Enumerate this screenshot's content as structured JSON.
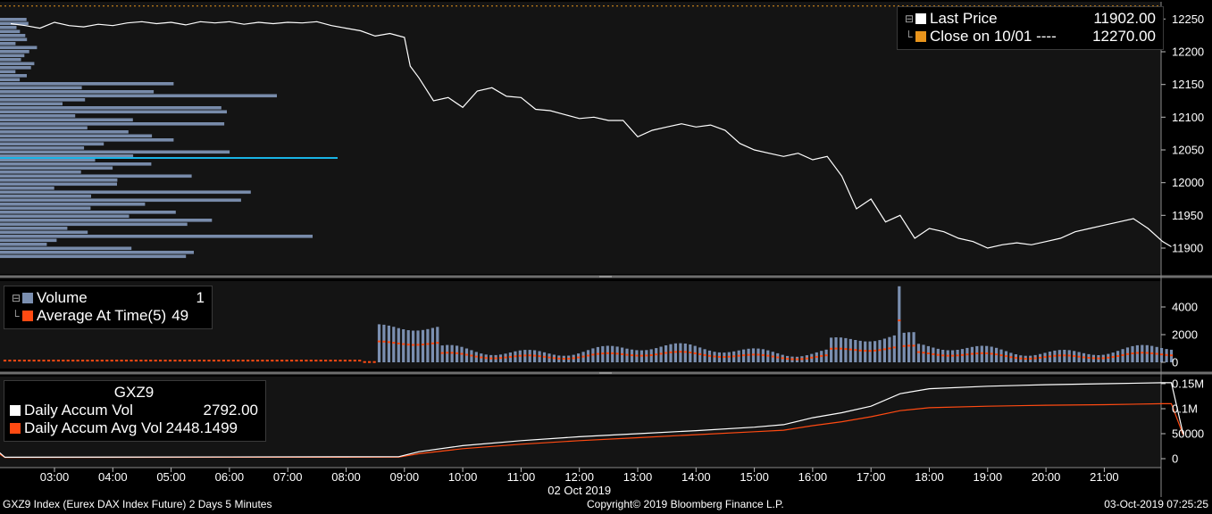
{
  "colors": {
    "background": "#000000",
    "panel": "#141414",
    "separator": "#6e6e6e",
    "price_line": "#ffffff",
    "close_line": "#e8941c",
    "volume_bar": "#7b8fb0",
    "average_marker": "#ff4a12",
    "profile_bar": "#8aa0c4",
    "poc_line": "#19b4e6",
    "accum_vol": "#ffffff",
    "accum_avg": "#ff4a12"
  },
  "chart_data": [
    {
      "type": "line",
      "panel": "price",
      "ylim": [
        11870,
        12270
      ],
      "yticks": [
        11900,
        11950,
        12000,
        12050,
        12100,
        12150,
        12200,
        12250
      ],
      "reference_line": {
        "label": "Close on 10/01",
        "value": 12270.0,
        "style": "dashed"
      },
      "series": [
        {
          "name": "Last Price",
          "last_value": 11902.0,
          "points": [
            [
              2.25,
              12243
            ],
            [
              2.5,
              12240
            ],
            [
              2.75,
              12236
            ],
            [
              3.0,
              12245
            ],
            [
              3.25,
              12240
            ],
            [
              3.5,
              12238
            ],
            [
              3.75,
              12242
            ],
            [
              4.0,
              12240
            ],
            [
              4.25,
              12244
            ],
            [
              4.5,
              12246
            ],
            [
              4.75,
              12243
            ],
            [
              5.0,
              12245
            ],
            [
              5.25,
              12241
            ],
            [
              5.5,
              12246
            ],
            [
              5.75,
              12244
            ],
            [
              6.0,
              12246
            ],
            [
              6.25,
              12242
            ],
            [
              6.5,
              12245
            ],
            [
              6.75,
              12243
            ],
            [
              7.0,
              12245
            ],
            [
              7.25,
              12244
            ],
            [
              7.5,
              12246
            ],
            [
              7.75,
              12240
            ],
            [
              8.0,
              12236
            ],
            [
              8.25,
              12232
            ],
            [
              8.5,
              12224
            ],
            [
              8.75,
              12228
            ],
            [
              9.0,
              12222
            ],
            [
              9.1,
              12178
            ],
            [
              9.25,
              12160
            ],
            [
              9.5,
              12125
            ],
            [
              9.75,
              12130
            ],
            [
              10.0,
              12115
            ],
            [
              10.25,
              12140
            ],
            [
              10.5,
              12145
            ],
            [
              10.75,
              12132
            ],
            [
              11.0,
              12130
            ],
            [
              11.25,
              12112
            ],
            [
              11.5,
              12110
            ],
            [
              11.75,
              12104
            ],
            [
              12.0,
              12098
            ],
            [
              12.25,
              12100
            ],
            [
              12.5,
              12095
            ],
            [
              12.75,
              12095
            ],
            [
              13.0,
              12070
            ],
            [
              13.25,
              12080
            ],
            [
              13.5,
              12085
            ],
            [
              13.75,
              12090
            ],
            [
              14.0,
              12085
            ],
            [
              14.25,
              12088
            ],
            [
              14.5,
              12080
            ],
            [
              14.75,
              12060
            ],
            [
              15.0,
              12050
            ],
            [
              15.25,
              12045
            ],
            [
              15.5,
              12040
            ],
            [
              15.75,
              12045
            ],
            [
              16.0,
              12035
            ],
            [
              16.25,
              12040
            ],
            [
              16.5,
              12010
            ],
            [
              16.75,
              11960
            ],
            [
              17.0,
              11975
            ],
            [
              17.25,
              11940
            ],
            [
              17.5,
              11950
            ],
            [
              17.75,
              11915
            ],
            [
              18.0,
              11930
            ],
            [
              18.25,
              11925
            ],
            [
              18.5,
              11915
            ],
            [
              18.75,
              11910
            ],
            [
              19.0,
              11900
            ],
            [
              19.25,
              11905
            ],
            [
              19.5,
              11908
            ],
            [
              19.75,
              11905
            ],
            [
              20.0,
              11910
            ],
            [
              20.25,
              11915
            ],
            [
              20.5,
              11925
            ],
            [
              20.75,
              11930
            ],
            [
              21.0,
              11935
            ],
            [
              21.25,
              11940
            ],
            [
              21.5,
              11945
            ],
            [
              21.75,
              11930
            ],
            [
              22.0,
              11910
            ],
            [
              22.15,
              11902
            ]
          ]
        }
      ]
    },
    {
      "type": "bar",
      "panel": "volume",
      "ylim": [
        0,
        5700
      ],
      "yticks": [
        0,
        2000,
        4000
      ],
      "series": [
        {
          "name": "Volume",
          "last_value": 1
        },
        {
          "name": "Average At Time(5)",
          "last_value": 49
        }
      ]
    },
    {
      "type": "line",
      "panel": "accumulation",
      "title": "GXZ9",
      "ylim": [
        -15000,
        170000
      ],
      "yticks": [
        0,
        50000,
        100000,
        150000
      ],
      "series": [
        {
          "name": "Daily Accum Vol",
          "last_value": 2792.0,
          "points": [
            [
              2.0,
              18000
            ],
            [
              2.15,
              2792
            ],
            [
              8.9,
              4000
            ],
            [
              9.25,
              14000
            ],
            [
              10.0,
              26000
            ],
            [
              11.0,
              36000
            ],
            [
              12.0,
              44000
            ],
            [
              13.0,
              50000
            ],
            [
              14.0,
              56000
            ],
            [
              15.0,
              63000
            ],
            [
              15.5,
              68000
            ],
            [
              16.0,
              82000
            ],
            [
              16.5,
              92000
            ],
            [
              17.0,
              105000
            ],
            [
              17.5,
              130000
            ],
            [
              18.0,
              140000
            ],
            [
              19.0,
              145000
            ],
            [
              20.0,
              148000
            ],
            [
              21.0,
              150000
            ],
            [
              22.0,
              152000
            ],
            [
              22.15,
              152000
            ],
            [
              22.35,
              50000
            ]
          ]
        },
        {
          "name": "Daily Accum Avg Vol",
          "last_value": 2448.1499,
          "points": [
            [
              2.0,
              14000
            ],
            [
              2.15,
              2448
            ],
            [
              8.9,
              3000
            ],
            [
              9.25,
              10000
            ],
            [
              10.0,
              20000
            ],
            [
              11.0,
              29000
            ],
            [
              12.0,
              36000
            ],
            [
              13.0,
              42000
            ],
            [
              14.0,
              48000
            ],
            [
              15.0,
              54000
            ],
            [
              15.5,
              57000
            ],
            [
              16.0,
              66000
            ],
            [
              16.5,
              74000
            ],
            [
              17.0,
              84000
            ],
            [
              17.5,
              96000
            ],
            [
              18.0,
              102000
            ],
            [
              19.0,
              105000
            ],
            [
              20.0,
              107000
            ],
            [
              21.0,
              108000
            ],
            [
              22.0,
              110000
            ],
            [
              22.15,
              110000
            ],
            [
              22.35,
              48000
            ]
          ]
        }
      ]
    }
  ],
  "x_axis": {
    "tick_labels": [
      "03:00",
      "04:00",
      "05:00",
      "06:00",
      "07:00",
      "08:00",
      "09:00",
      "10:00",
      "11:00",
      "12:00",
      "13:00",
      "14:00",
      "15:00",
      "16:00",
      "17:00",
      "18:00",
      "19:00",
      "20:00",
      "21:00"
    ],
    "date_label": "02 Oct 2019"
  },
  "legend_price": {
    "last_label": "Last Price",
    "last_value": "11902.00",
    "close_label": "Close on 10/01 ----",
    "close_value": "12270.00"
  },
  "legend_volume": {
    "vol_label": "Volume",
    "vol_value": "1",
    "avg_label": "Average At Time(5)",
    "avg_value": "49"
  },
  "legend_accum": {
    "title": "GXZ9",
    "acc_label": "Daily Accum Vol",
    "acc_value": "2792.00",
    "avg_label": "Daily Accum Avg Vol",
    "avg_value": "2448.1499"
  },
  "footer": {
    "left": "GXZ9 Index (Eurex DAX Index Future) 2 Days 5 Minutes",
    "center": "Copyright© 2019 Bloomberg Finance L.P.",
    "right": "03-Oct-2019 07:25:25"
  },
  "axis_labels": {
    "price": [
      "11900",
      "11950",
      "12000",
      "12050",
      "12100",
      "12150",
      "12200",
      "12250"
    ],
    "volume": [
      "0",
      "2000",
      "4000"
    ],
    "accum": [
      "0",
      "50000",
      "0.1M",
      "0.15M"
    ]
  }
}
